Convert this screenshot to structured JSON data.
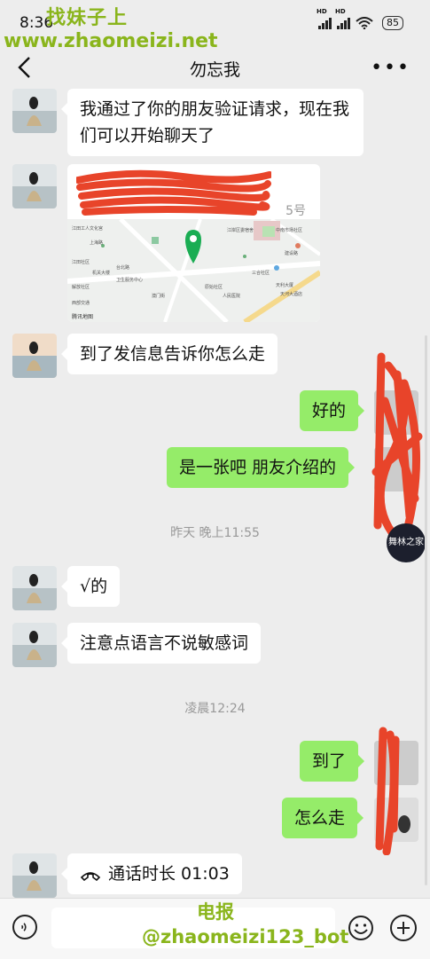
{
  "status_bar": {
    "time": "8:36",
    "battery": "85",
    "network1": "HD",
    "network2": "HD"
  },
  "watermarks": {
    "top_cn": "找妹子上",
    "top_url": "www.zhaomeizi.net",
    "bottom_cn": "电报",
    "bottom_handle": "@zhaomeizi123_bot"
  },
  "header": {
    "title": "勿忘我"
  },
  "messages": [
    {
      "side": "left",
      "text": "我通过了你的朋友验证请求，现在我们可以开始聊天了"
    },
    {
      "side": "left",
      "type": "location",
      "address_suffix": "5号"
    },
    {
      "side": "left",
      "text": "到了发信息告诉你怎么走"
    },
    {
      "side": "right",
      "text": "好的"
    },
    {
      "side": "right",
      "text": "是一张吧 朋友介绍的"
    },
    {
      "type": "timestamp",
      "text": "昨天 晚上11:55"
    },
    {
      "side": "left",
      "text": "√的"
    },
    {
      "side": "left",
      "text": "注意点语言不说敏感词"
    },
    {
      "type": "timestamp",
      "text": "凌晨12:24"
    },
    {
      "side": "right",
      "text": "到了"
    },
    {
      "side": "right",
      "text": "怎么走"
    },
    {
      "side": "left",
      "type": "call",
      "text": "通话时长 01:03"
    }
  ],
  "map_labels": {
    "tencent_map": "腾讯地图",
    "labels": [
      "江田工人文化宫",
      "上海路",
      "江岸区委宿舍",
      "中南市场社区",
      "江田社区",
      "建设路",
      "台北路",
      "解放社区",
      "原始社区",
      "卫生服务中心",
      "机关大楼",
      "澳门街",
      "三合社区",
      "人民医院",
      "西部交通",
      "天利大厦",
      "天河大酒店"
    ]
  },
  "badge": {
    "text": "舞林之家"
  },
  "colors": {
    "background": "#ededed",
    "bubble_right": "#95ec69",
    "bubble_left": "#ffffff",
    "watermark": "#8ab51c",
    "redaction": "#e8442a"
  },
  "icons": {
    "back": "chevron-left-icon",
    "more": "more-dots-icon",
    "voice": "voice-icon",
    "emoji": "emoji-icon",
    "plus": "plus-icon",
    "call": "phone-icon",
    "map_pin": "map-pin-icon"
  }
}
